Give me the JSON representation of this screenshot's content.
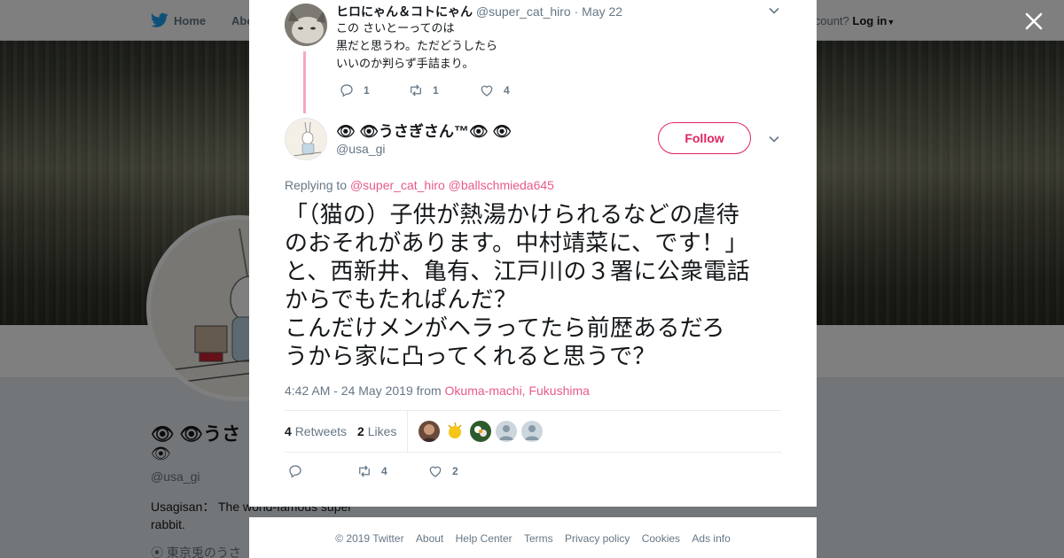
{
  "background_page": {
    "nav": {
      "home_label": "Home",
      "about_label": "Abo",
      "account_prompt": "account?",
      "login_label": "Log in"
    },
    "profile": {
      "name": "👁 👁うさ",
      "name_line2": "👁",
      "handle": "@usa_gi",
      "bio": "Usagisan： The world-famous super rabbit.",
      "location": "東京兎のうさ"
    }
  },
  "modal": {
    "parent_tweet": {
      "name": "ヒロにゃん＆コトにゃん",
      "handle": "@super_cat_hiro",
      "separator": "·",
      "date": "May 22",
      "text_lines": [
        "この さいとーってのは",
        "黒だと思うわ。ただどうしたら",
        "いいのか判らず手詰まり。"
      ],
      "replies": "1",
      "retweets": "1",
      "likes": "4"
    },
    "main_tweet": {
      "display_name": "👁 👁うさぎさん™👁 👁",
      "handle": "@usa_gi",
      "follow_label": "Follow",
      "replying_prefix": "Replying to",
      "replying_to": [
        "@super_cat_hiro",
        "@ballschmieda645"
      ],
      "text": "「（猫の）子供が熱湯かけられるなどの虐待\nのおそれがあります。中村靖菜に、です！」\nと、西新井、亀有、江戸川の３署に公衆電話\nからでもたれぱんだ？\nこんだけメンがヘラってたら前歴あるだろ\nうから家に凸ってくれると思うで？",
      "timestamp": "4:42 AM - 24 May 2019",
      "from_label": "from",
      "location": "Okuma-machi, Fukushima",
      "retweets_count": "4",
      "retweets_label": "Retweets",
      "likes_count": "2",
      "likes_label": "Likes",
      "reply_count": "",
      "retweet_action_count": "4",
      "like_action_count": "2"
    }
  },
  "footer": {
    "links": [
      "© 2019 Twitter",
      "About",
      "Help Center",
      "Terms",
      "Privacy policy",
      "Cookies",
      "Ads info"
    ]
  },
  "colors": {
    "accent": "#e0245e",
    "twitter_blue": "#1da1f2",
    "secondary_text": "#657786"
  }
}
